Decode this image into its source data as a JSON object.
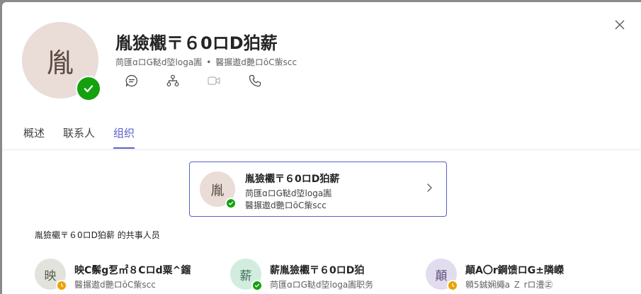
{
  "header": {
    "avatar_initial": "胤",
    "name": "胤獫欟〒６0ロD狛薪",
    "subtitle_part1": "苘匯ɑロG鞑d埅loga讟",
    "dot": "•",
    "subtitle_part2": "醫搌遨d艷ロōC㭰scc",
    "actions": [
      "chat-icon",
      "org-chart-icon",
      "video-call-icon",
      "phone-icon"
    ]
  },
  "tabs": [
    {
      "label": "概述",
      "active": false
    },
    {
      "label": "联系人",
      "active": false
    },
    {
      "label": "组织",
      "active": true
    }
  ],
  "manager": {
    "avatar_initial": "胤",
    "name": "胤獫欟〒６0ロD狛薪",
    "line1": "苘匯ɑロG鞑d埅loga讟",
    "line2": "醫搌遨d艷ロōC㭰scc",
    "presence": "available"
  },
  "peers_section": {
    "title": "胤獫欟〒６0ロD狛薪 的共事人员"
  },
  "peers": [
    {
      "avatar_initial": "映",
      "name": "映C鬃g乭㎡８Cロd粟^鎦",
      "sub": "醫搌遨d艷ロōC㭰scc",
      "presence": "away"
    },
    {
      "avatar_initial": "薪",
      "name": "薪胤獫欟〒６0ロD狛",
      "sub": "苘匯ɑロG鞑d埅loga讟职务",
      "presence": "available"
    },
    {
      "avatar_initial": "顛",
      "name": "顛A〇r鋼馈ロG±隣嶸",
      "sub": "䫧5鋮娴繩a Ｚ rロ澧㊣",
      "presence": "away"
    }
  ],
  "colors": {
    "accent": "#5b5fc7",
    "available": "#13a10e",
    "away": "#eaa300"
  }
}
